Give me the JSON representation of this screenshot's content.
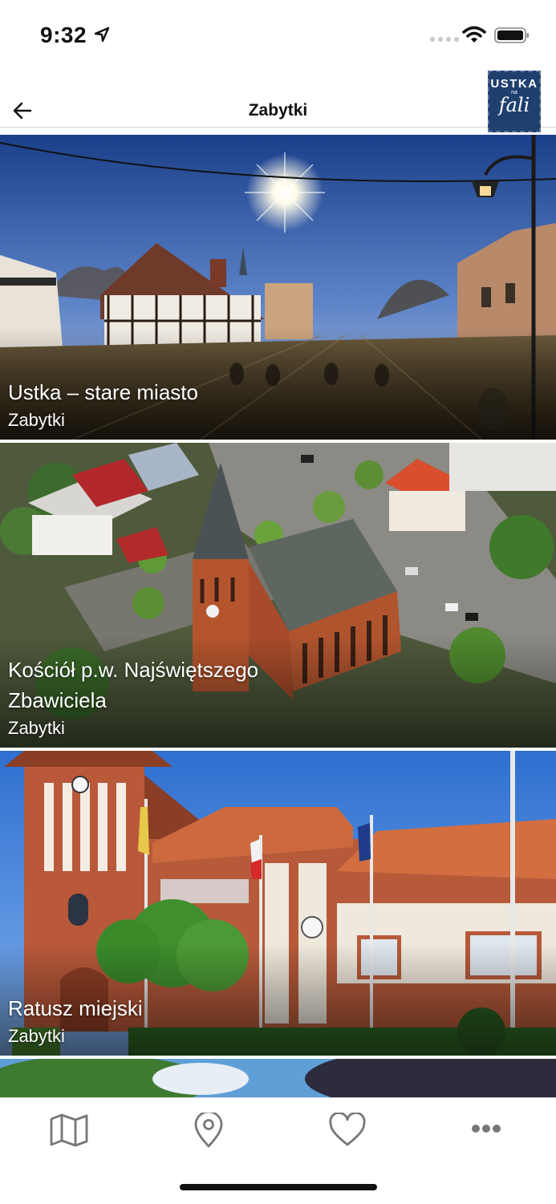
{
  "status_bar": {
    "time": "9:32"
  },
  "header": {
    "title": "Zabytki",
    "logo": {
      "line1": "USTKA",
      "line2": "na",
      "line3": "fali"
    }
  },
  "items": [
    {
      "title": "Ustka – stare miasto",
      "category": "Zabytki"
    },
    {
      "title": "Kościół p.w. Najświętszego Zbawiciela",
      "category": "Zabytki"
    },
    {
      "title": "Ratusz miejski",
      "category": "Zabytki"
    }
  ],
  "tab_bar": {
    "icons": [
      "map-icon",
      "location-pin-icon",
      "heart-icon",
      "more-icon"
    ]
  }
}
